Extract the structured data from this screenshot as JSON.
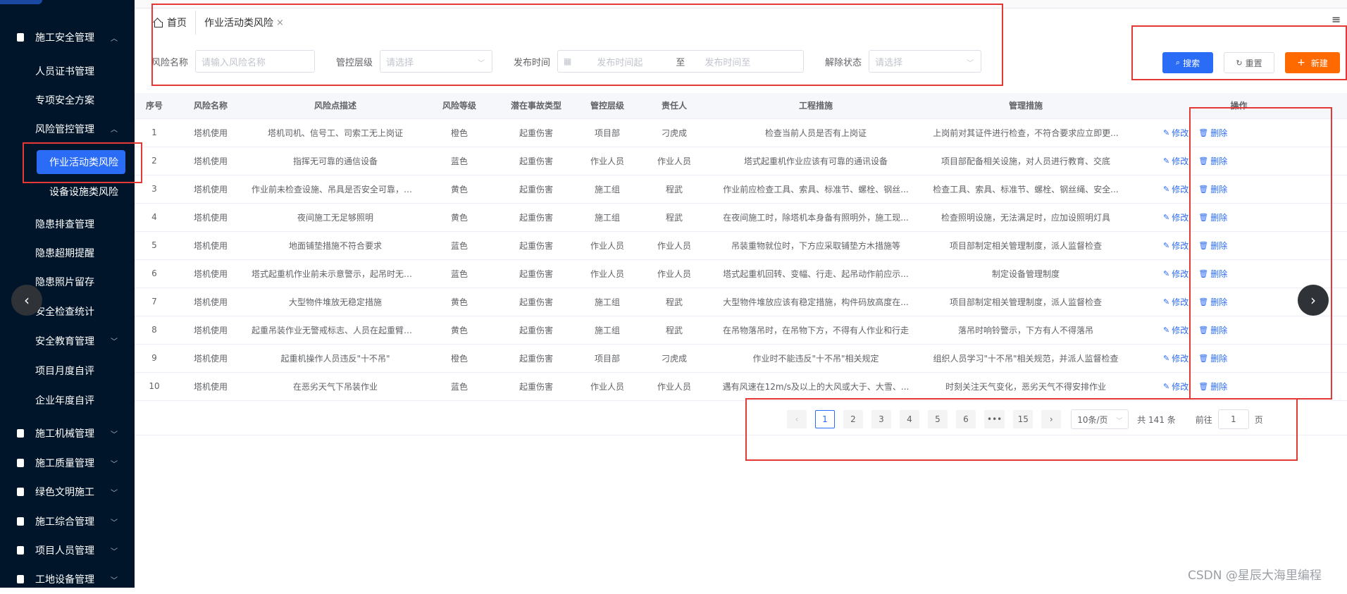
{
  "sidebar": {
    "groups": [
      {
        "label": "施工安全管理",
        "icon": "building-icon",
        "expanded": true
      },
      {
        "label": "施工机械管理",
        "icon": "building-icon",
        "expanded": false
      },
      {
        "label": "施工质量管理",
        "icon": "document-icon",
        "expanded": false
      },
      {
        "label": "绿色文明施工",
        "icon": "user-icon",
        "expanded": false
      },
      {
        "label": "施工综合管理",
        "icon": "id-card-icon",
        "expanded": false
      },
      {
        "label": "项目人员管理",
        "icon": "users-icon",
        "expanded": false
      },
      {
        "label": "工地设备管理",
        "icon": "user-icon",
        "expanded": false
      }
    ],
    "items": [
      {
        "label": "人员证书管理"
      },
      {
        "label": "专项安全方案"
      },
      {
        "label": "风险管控管理"
      },
      {
        "label": "隐患排查管理"
      },
      {
        "label": "隐患超期提醒"
      },
      {
        "label": "隐患照片留存"
      },
      {
        "label": "安全检查统计"
      },
      {
        "label": "安全教育管理"
      },
      {
        "label": "项目月度自评"
      },
      {
        "label": "企业年度自评"
      }
    ],
    "subitems": [
      {
        "label": "作业活动类风险",
        "active": true
      },
      {
        "label": "设备设施类风险",
        "active": false
      }
    ]
  },
  "tabs": [
    {
      "label": "首页"
    },
    {
      "label": "作业活动类风险",
      "closable": true
    }
  ],
  "filters": {
    "risk_name_label": "风险名称",
    "risk_name_placeholder": "请输入风险名称",
    "control_level_label": "管控层级",
    "control_level_placeholder": "请选择",
    "publish_time_label": "发布时间",
    "publish_start_placeholder": "发布时间起",
    "publish_range_sep": "至",
    "publish_end_placeholder": "发布时间至",
    "release_status_label": "解除状态",
    "release_status_placeholder": "请选择"
  },
  "buttons": {
    "search": "搜索",
    "reset": "重置",
    "add": "新建"
  },
  "table": {
    "columns": [
      "序号",
      "风险名称",
      "风险点描述",
      "风险等级",
      "潜在事故类型",
      "管控层级",
      "责任人",
      "工程措施",
      "管理措施",
      "操作"
    ],
    "rows": [
      [
        "1",
        "塔机使用",
        "塔机司机、信号工、司索工无上岗证",
        "橙色",
        "起重伤害",
        "项目部",
        "刁虎成",
        "检查当前人员是否有上岗证",
        "上岗前对其证件进行检查，不符合要求应立即更..."
      ],
      [
        "2",
        "塔机使用",
        "指挥无可靠的通信设备",
        "蓝色",
        "起重伤害",
        "作业人员",
        "作业人员",
        "塔式起重机作业应该有可靠的通讯设备",
        "项目部配备相关设施，对人员进行教育、交底"
      ],
      [
        "3",
        "塔机使用",
        "作业前未检查设施、吊具是否安全可靠，就开始...",
        "黄色",
        "起重伤害",
        "施工组",
        "程武",
        "作业前应检查工具、索具、标准节、螺栓、钢丝...",
        "检查工具、索具、标准节、螺栓、钢丝绳、安全..."
      ],
      [
        "4",
        "塔机使用",
        "夜间施工无足够照明",
        "黄色",
        "起重伤害",
        "施工组",
        "程武",
        "在夜间施工时，除塔机本身备有照明外，施工现...",
        "检查照明设施，无法满足时，应加设照明灯具"
      ],
      [
        "5",
        "塔机使用",
        "地面铺垫措施不符合要求",
        "蓝色",
        "起重伤害",
        "作业人员",
        "作业人员",
        "吊装重物就位时，下方应采取铺垫方木措施等",
        "项目部制定相关管理制度，派人监督检查"
      ],
      [
        "6",
        "塔机使用",
        "塔式起重机作业前未示意警示，起吊时无统一指挥",
        "蓝色",
        "起重伤害",
        "作业人员",
        "作业人员",
        "塔式起重机回转、变幅、行走、起吊动作前应示...",
        "制定设备管理制度"
      ],
      [
        "7",
        "塔机使用",
        "大型物件堆放无稳定措施",
        "黄色",
        "起重伤害",
        "施工组",
        "程武",
        "大型物件堆放应该有稳定措施，构件码放高度在...",
        "项目部制定相关管理制度，派人监督检查"
      ],
      [
        "8",
        "塔机使用",
        "起重吊装作业无警戒标志、人员在起重臂下停留",
        "黄色",
        "起重伤害",
        "施工组",
        "程武",
        "在吊物落吊时，在吊物下方，不得有人作业和行走",
        "落吊时响铃警示，下方有人不得落吊"
      ],
      [
        "9",
        "塔机使用",
        "起重机操作人员违反\"十不吊\"",
        "橙色",
        "起重伤害",
        "项目部",
        "刁虎成",
        "作业时不能违反\"十不吊\"相关规定",
        "组织人员学习\"十不吊\"相关规范，并派人监督检查"
      ],
      [
        "10",
        "塔机使用",
        "在恶劣天气下吊装作业",
        "蓝色",
        "起重伤害",
        "作业人员",
        "作业人员",
        "遇有风速在12m/s及以上的大风或大于、大雪、...",
        "时刻关注天气变化，恶劣天气不得安排作业"
      ]
    ],
    "row_actions": {
      "edit": "修改",
      "delete": "删除"
    }
  },
  "pagination": {
    "pages": [
      "1",
      "2",
      "3",
      "4",
      "5",
      "6",
      "•••",
      "15"
    ],
    "current": "1",
    "page_size": "10条/页",
    "total": "共 141 条",
    "goto_label": "前往",
    "goto_value": "1",
    "goto_unit": "页"
  },
  "watermark": "CSDN @星辰大海里编程",
  "colors": {
    "primary": "#2b6cf6",
    "add": "#ff6a00",
    "sidebar": "#001529",
    "annotation": "#e53935"
  }
}
